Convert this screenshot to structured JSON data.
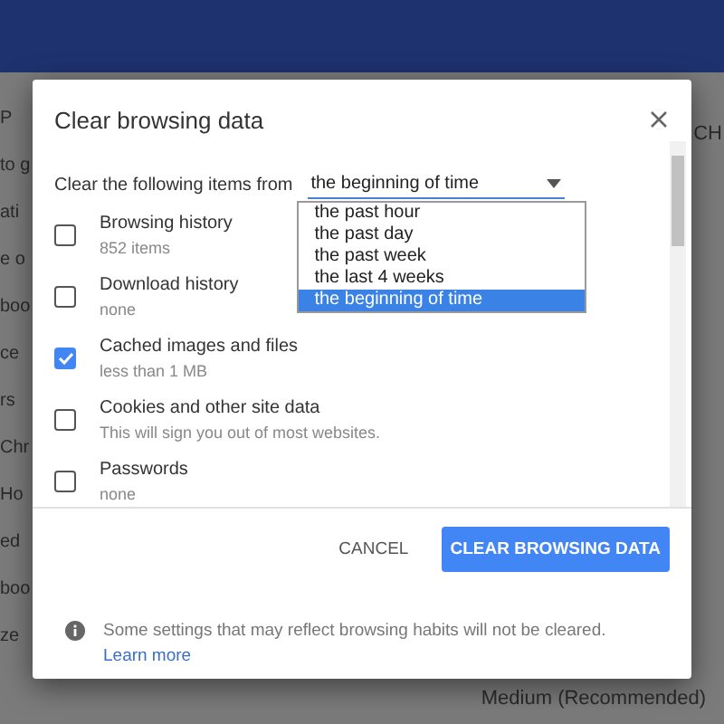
{
  "background": {
    "left_fragments": [
      "P",
      "to g",
      "ati",
      "e o",
      "boo",
      "ce",
      "rs",
      "Chr",
      "Ho",
      "ed",
      "boo",
      "ze"
    ],
    "right_fragments": [
      "CH",
      "Medium (Recommended)"
    ]
  },
  "dialog": {
    "title": "Clear browsing data",
    "time_range": {
      "label": "Clear the following items from",
      "value": "the beginning of time",
      "expanded": true,
      "options": [
        {
          "label": "the past hour",
          "selected": false
        },
        {
          "label": "the past day",
          "selected": false
        },
        {
          "label": "the past week",
          "selected": false
        },
        {
          "label": "the last 4 weeks",
          "selected": false
        },
        {
          "label": "the beginning of time",
          "selected": true
        }
      ]
    },
    "items": [
      {
        "label": "Browsing history",
        "detail": "852 items",
        "checked": false
      },
      {
        "label": "Download history",
        "detail": "none",
        "checked": false
      },
      {
        "label": "Cached images and files",
        "detail": "less than 1 MB",
        "checked": true
      },
      {
        "label": "Cookies and other site data",
        "detail": "This will sign you out of most websites.",
        "checked": false
      },
      {
        "label": "Passwords",
        "detail": "none",
        "checked": false
      }
    ],
    "buttons": {
      "cancel": "CANCEL",
      "confirm": "CLEAR BROWSING DATA"
    },
    "note": {
      "text": "Some settings that may reflect browsing habits will not be cleared.",
      "link": "Learn more"
    }
  }
}
